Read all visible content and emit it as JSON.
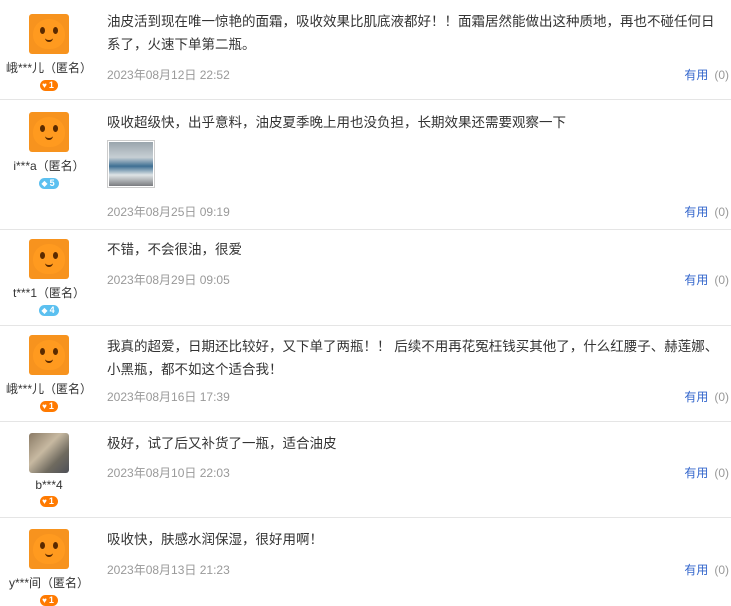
{
  "reviews": [
    {
      "username": "峨***儿（匿名）",
      "avatar": "orange-mascot",
      "level": "1",
      "level_icon": "heart",
      "text": "油皮活到现在唯一惊艳的面霜，吸收效果比肌底液都好！！面霜居然能做出这种质地，再也不碰任何日系了，火速下单第二瓶。",
      "date": "2023年08月12日 22:52",
      "useful_label": "有用",
      "useful_count": "(0)"
    },
    {
      "username": "i***a（匿名）",
      "avatar": "orange-mascot",
      "level": "5",
      "level_icon": "diamond",
      "text": "吸收超级快，出乎意料，油皮夏季晚上用也没负担，长期效果还需要观察一下",
      "has_photo": true,
      "date": "2023年08月25日 09:19",
      "useful_label": "有用",
      "useful_count": "(0)"
    },
    {
      "username": "t***1（匿名）",
      "avatar": "orange-mascot",
      "level": "4",
      "level_icon": "diamond",
      "text": "不错，不会很油，很爱",
      "date": "2023年08月29日 09:05",
      "useful_label": "有用",
      "useful_count": "(0)"
    },
    {
      "username": "峨***儿（匿名）",
      "avatar": "orange-mascot",
      "level": "1",
      "level_icon": "heart",
      "text": "我真的超爱，日期还比较好，又下单了两瓶！！ 后续不用再花冤枉钱买其他了，什么红腰子、赫莲娜、小黑瓶，都不如这个适合我！",
      "date": "2023年08月16日 17:39",
      "useful_label": "有用",
      "useful_count": "(0)"
    },
    {
      "username": "b***4",
      "avatar": "cat-photo",
      "level": "1",
      "level_icon": "heart",
      "text": "极好，试了后又补货了一瓶，适合油皮",
      "date": "2023年08月10日 22:03",
      "useful_label": "有用",
      "useful_count": "(0)"
    },
    {
      "username": "y***间（匿名）",
      "avatar": "orange-mascot",
      "level": "1",
      "level_icon": "heart",
      "text": "吸收快，肤感水润保湿，很好用啊！",
      "date": "2023年08月13日 21:23",
      "useful_label": "有用",
      "useful_count": "(0)"
    }
  ]
}
